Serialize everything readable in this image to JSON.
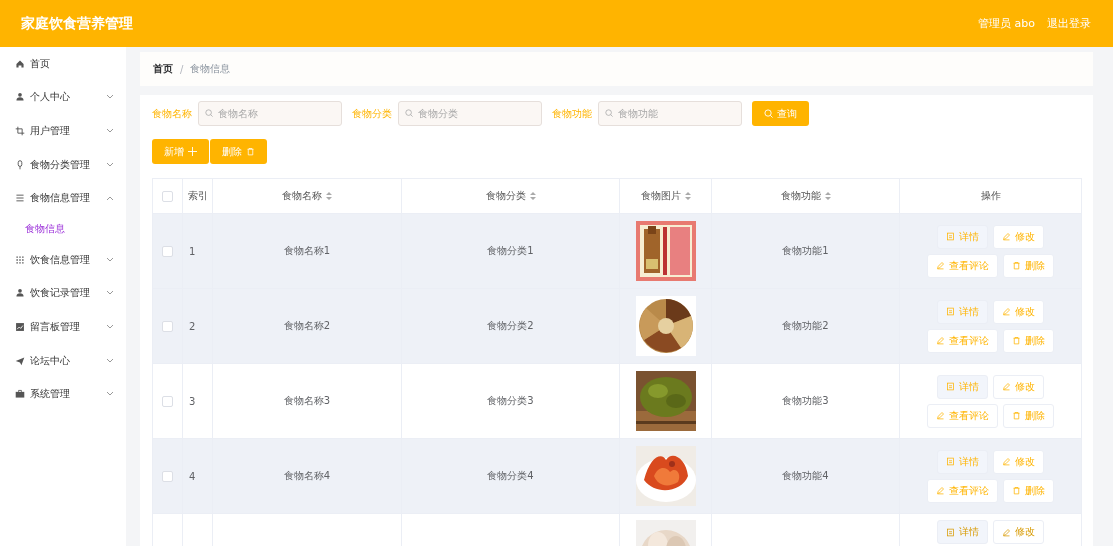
{
  "header": {
    "title": "家庭饮食营养管理",
    "user": "管理员 abo",
    "logout": "退出登录"
  },
  "sidebar": {
    "items": [
      {
        "label": "首页",
        "kind": "link"
      },
      {
        "label": "个人中心",
        "kind": "menu",
        "expanded": false
      },
      {
        "label": "用户管理",
        "kind": "menu",
        "expanded": false
      },
      {
        "label": "食物分类管理",
        "kind": "menu",
        "expanded": false
      },
      {
        "label": "食物信息管理",
        "kind": "menu",
        "expanded": true,
        "children": [
          {
            "label": "食物信息",
            "selected": true
          }
        ]
      },
      {
        "label": "饮食信息管理",
        "kind": "menu",
        "expanded": false
      },
      {
        "label": "饮食记录管理",
        "kind": "menu",
        "expanded": false
      },
      {
        "label": "留言板管理",
        "kind": "menu",
        "expanded": false
      },
      {
        "label": "论坛中心",
        "kind": "menu",
        "expanded": false
      },
      {
        "label": "系统管理",
        "kind": "menu",
        "expanded": false
      }
    ]
  },
  "breadcrumb": {
    "items": [
      "首页",
      "食物信息"
    ],
    "separator": "/"
  },
  "search": {
    "fields": [
      {
        "label": "食物名称",
        "placeholder": "食物名称"
      },
      {
        "label": "食物分类",
        "placeholder": "食物分类"
      },
      {
        "label": "食物功能",
        "placeholder": "食物功能"
      }
    ],
    "button": "查询"
  },
  "toolbar": {
    "add": "新增",
    "delete": "删除"
  },
  "table": {
    "select_all": {
      "checked": false
    },
    "columns": [
      "索引",
      "食物名称",
      "食物分类",
      "食物图片",
      "食物功能",
      "操作"
    ],
    "rows": [
      {
        "checked": false,
        "index": "1",
        "name": "食物名称1",
        "category": "食物分类1",
        "image": {
          "kind": "picture"
        },
        "function": "食物功能1",
        "highlighted": true,
        "actions": [
          "详情",
          "修改",
          "查看评论",
          "删除"
        ]
      },
      {
        "checked": false,
        "index": "2",
        "name": "食物名称2",
        "category": "食物分类2",
        "image": {
          "kind": "picture"
        },
        "function": "食物功能2",
        "highlighted": true,
        "actions": [
          "详情",
          "修改",
          "查看评论",
          "删除"
        ]
      },
      {
        "checked": false,
        "index": "3",
        "name": "食物名称3",
        "category": "食物分类3",
        "image": {
          "kind": "picture"
        },
        "function": "食物功能3",
        "highlighted": false,
        "actions": [
          "详情",
          "修改",
          "查看评论",
          "删除"
        ]
      },
      {
        "checked": false,
        "index": "4",
        "name": "食物名称4",
        "category": "食物分类4",
        "image": {
          "kind": "picture"
        },
        "function": "食物功能4",
        "highlighted": true,
        "actions": [
          "详情",
          "修改",
          "查看评论",
          "删除"
        ]
      },
      {
        "image": {
          "kind": "picture"
        },
        "actions": [
          "详情",
          "修改"
        ]
      }
    ]
  }
}
